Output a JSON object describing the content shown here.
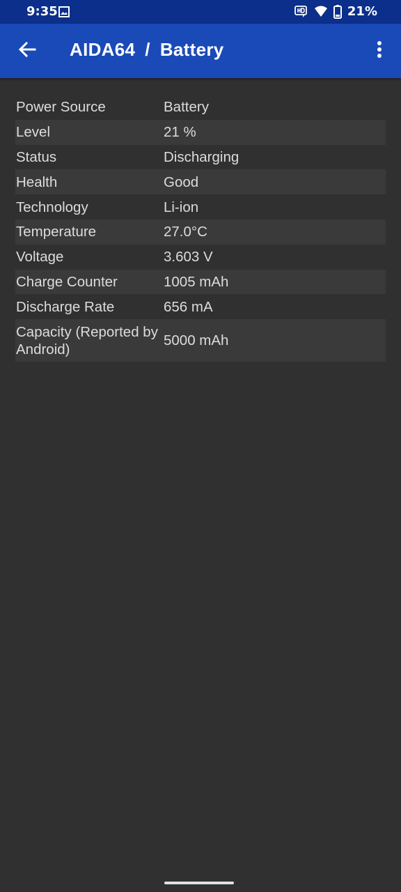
{
  "status_bar": {
    "time": "9:35",
    "battery_percent": "21%",
    "icons": [
      "image-icon",
      "hd-voice-icon",
      "wifi-icon",
      "battery-icon"
    ]
  },
  "app_bar": {
    "app_name": "AIDA64",
    "separator": "/",
    "page_name": "Battery",
    "back_icon": "arrow-left-icon",
    "menu_icon": "more-vert-icon"
  },
  "battery_info": {
    "rows": [
      {
        "label": "Power Source",
        "value": "Battery"
      },
      {
        "label": "Level",
        "value": "21 %"
      },
      {
        "label": "Status",
        "value": "Discharging"
      },
      {
        "label": "Health",
        "value": "Good"
      },
      {
        "label": "Technology",
        "value": "Li-ion"
      },
      {
        "label": "Temperature",
        "value": "27.0°C"
      },
      {
        "label": "Voltage",
        "value": "3.603 V"
      },
      {
        "label": "Charge Counter",
        "value": "1005 mAh"
      },
      {
        "label": "Discharge Rate",
        "value": "656 mA"
      },
      {
        "label": "Capacity (Reported by Android)",
        "value": "5000 mAh"
      }
    ]
  },
  "colors": {
    "status_bar_bg": "#0b2f8a",
    "app_bar_bg": "#1a4ab7",
    "page_bg": "#303030",
    "alt_row_bg": "#3a3a3a",
    "text": "#dcdcdc"
  }
}
